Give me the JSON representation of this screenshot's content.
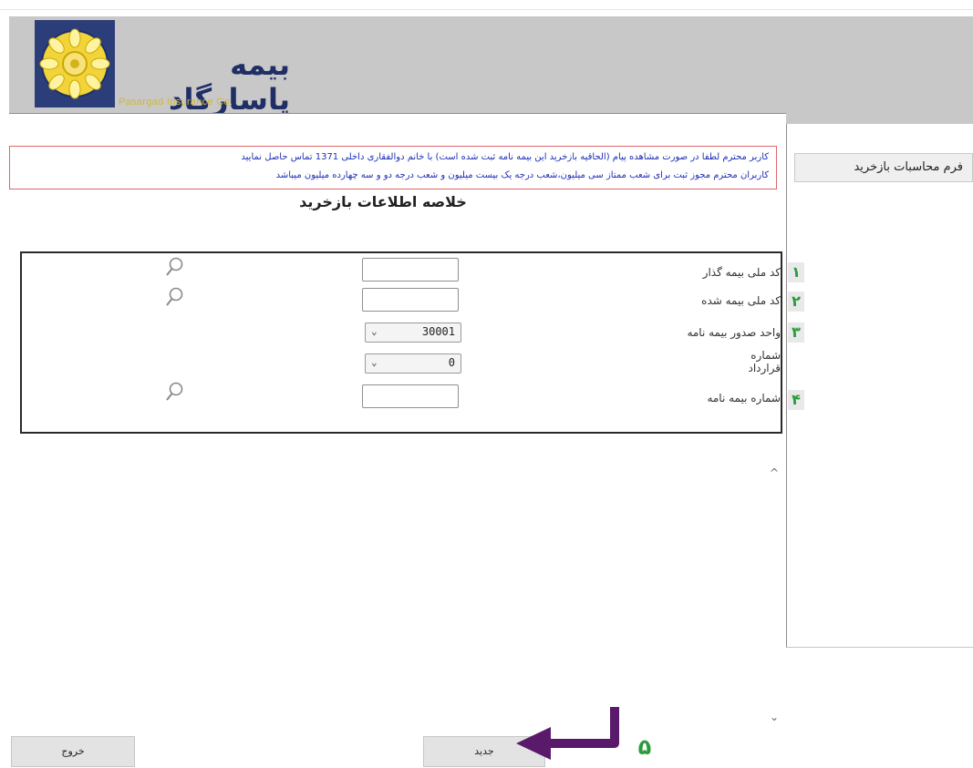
{
  "brand": {
    "name_fa": "بیمه پاسارگاد",
    "name_en": "Pasargad Insurance Co."
  },
  "sidebar": {
    "items": [
      {
        "label": "فرم محاسبات بازخرید"
      }
    ]
  },
  "alert": {
    "line1": "کاربر محترم لطفا در صورت مشاهده پیام (الحاقیه بازخرید این بیمه نامه ثبت شده است) با خانم دوالفقاری داخلی 1371 تماس حاصل نمایید",
    "line2": "کاربران محترم مجوز ثبت برای شعب ممتاز سی میلیون،شعب درجه یک بیست میلیون و شعب درجه دو و سه چهارده میلیون میباشد"
  },
  "form": {
    "title": "خلاصه اطلاعات بازخرید",
    "rows": [
      {
        "step": "۱",
        "label": "کد ملی بیمه گذار",
        "value": ""
      },
      {
        "step": "۲",
        "label": "کد ملی بیمه شده",
        "value": ""
      },
      {
        "step": "۳",
        "label": "واحد صدور بیمه نامه",
        "value": "30001"
      },
      {
        "step": "",
        "label": "شماره قرارداد",
        "value": "0"
      },
      {
        "step": "۴",
        "label": "شماره بیمه نامه",
        "value": ""
      }
    ]
  },
  "buttons": {
    "exit": "خروج",
    "new": "جدید"
  },
  "annotations": {
    "step5": "۵"
  },
  "colors": {
    "header_bg": "#c8c8c8",
    "alert_border": "#e0666a",
    "alert_text": "#1f2fb5",
    "step_green": "#2a9b3c",
    "arrow_purple": "#5a1a6b"
  },
  "icons": {
    "lookup": "magnifier-icon",
    "dropdown": "chevron-down-icon"
  }
}
